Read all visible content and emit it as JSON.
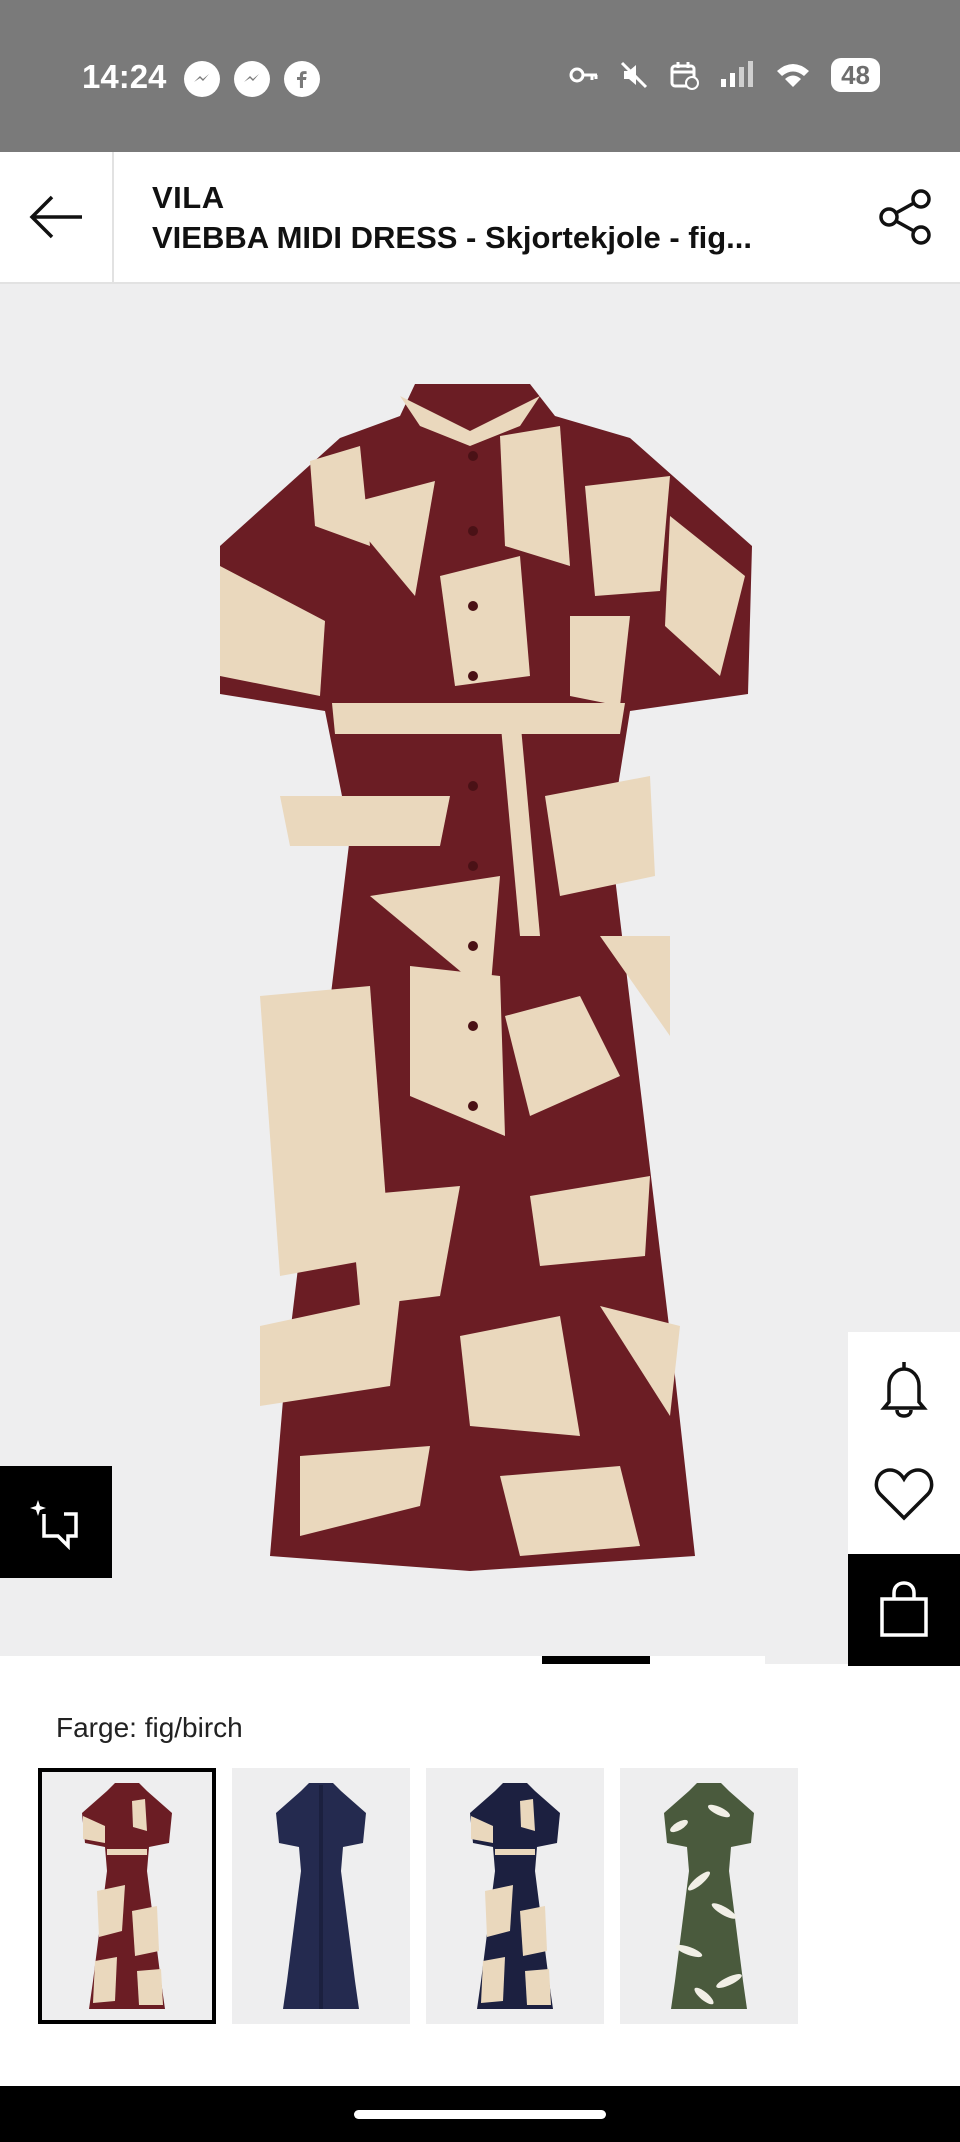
{
  "status_bar": {
    "time": "14:24",
    "battery": "48",
    "apps": [
      "messenger-icon",
      "messenger-icon",
      "facebook-icon"
    ],
    "icons": [
      "key-icon",
      "mute-icon",
      "calendar-icon",
      "signal-icon",
      "wifi-icon",
      "battery-icon"
    ]
  },
  "header": {
    "brand": "VILA",
    "title": "VIEBBA MIDI DRESS - Skjortekjole - fig...",
    "back_icon": "back-arrow-icon",
    "share_icon": "share-icon"
  },
  "colors": {
    "dress_primary": "#6b1d24",
    "dress_secondary": "#ead8bd",
    "navy": "#242a4f",
    "green": "#4a5a3d",
    "image_bg": "#eeeeef"
  },
  "product": {
    "color_label": "Farge: fig/birch",
    "swatches": [
      {
        "name": "fig/birch",
        "selected": true
      },
      {
        "name": "navy",
        "selected": false
      },
      {
        "name": "navy pattern",
        "selected": false
      },
      {
        "name": "green leaf",
        "selected": false
      }
    ]
  },
  "side_actions": [
    "bell-icon",
    "heart-icon",
    "bag-icon"
  ],
  "gallery": {
    "active_index": 2
  }
}
